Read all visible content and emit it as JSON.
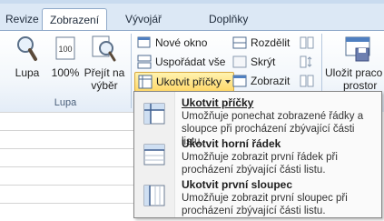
{
  "tabs": [
    "Revize",
    "Zobrazení",
    "Vývojář",
    "Doplňky"
  ],
  "ribbon": {
    "lupa_group": {
      "label": "Lupa",
      "zoom": "Lupa",
      "zoom100": "100%",
      "zoom_selection_line1": "Přejít na",
      "zoom_selection_line2": "výběr"
    },
    "window_group": {
      "new_window": "Nové okno",
      "arrange_all": "Uspořádat vše",
      "freeze_panes": "Ukotvit příčky",
      "split": "Rozdělit",
      "hide": "Skrýt",
      "unhide": "Zobrazit",
      "save_workspace_line1": "Uložit praco",
      "save_workspace_line2": "prostor"
    }
  },
  "freeze_menu": [
    {
      "title": "Ukotvit příčky",
      "desc": "Umožňuje ponechat zobrazené řádky a sloupce při procházení zbývající části listu."
    },
    {
      "title": "Ukotvit horní řádek",
      "desc": "Umožňuje zobrazit první řádek při procházení zbývající části listu."
    },
    {
      "title": "Ukotvit první sloupec",
      "desc": "Umožňuje zobrazit první sloupec při procházení zbývající části listu."
    }
  ],
  "colors": {
    "highlight": "#ffd96a",
    "ribbon_border": "#8fa9c9"
  }
}
